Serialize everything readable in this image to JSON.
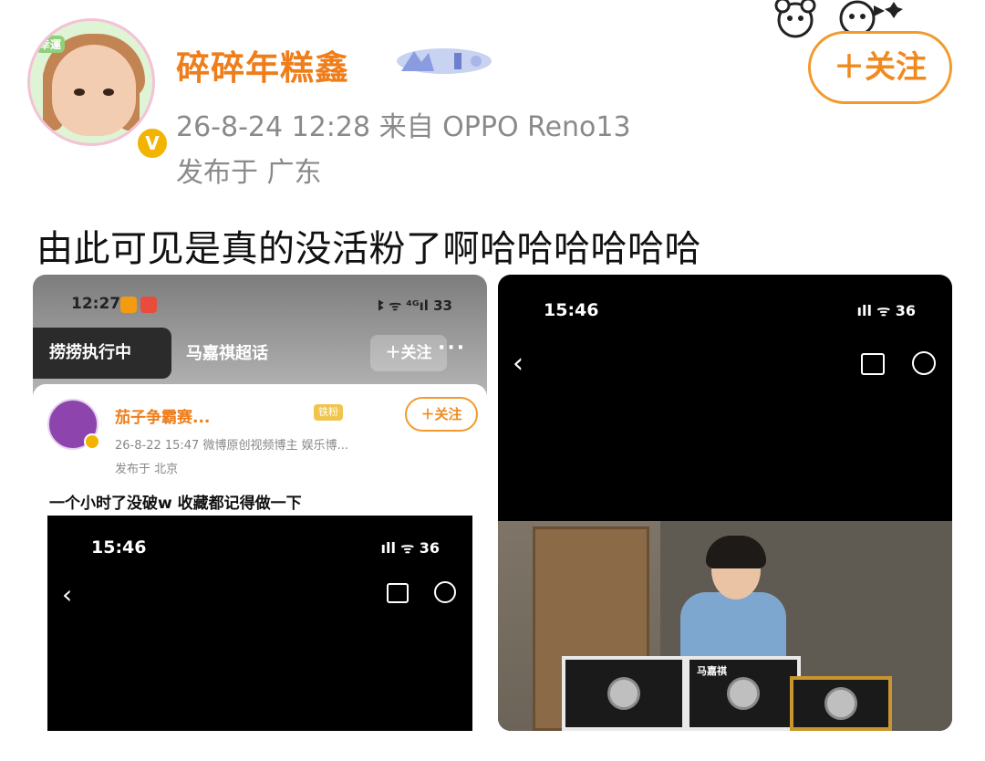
{
  "post": {
    "username": "碎碎年糕鑫",
    "avatar_tag": "幸運",
    "meta": "26-8-24 12:28  来自 OPPO Reno13",
    "location": "发布于 广东",
    "follow_label": "＋关注",
    "text": "由此可见是真的没活粉了啊哈哈哈哈哈哈"
  },
  "left_image": {
    "status_time": "12:27",
    "status_right": "ꔪ ᯤ ⁴ᴳıl 33",
    "chip_label": "捞捞执行中",
    "topic": "马嘉祺超话",
    "topic_follow": "＋关注",
    "more": "···",
    "card": {
      "name": "茄子争霸赛...",
      "name_badge": "铁粉",
      "follow_label": "＋关注",
      "meta": "26-8-22 15:47  微博原创视频博主 娱乐博...",
      "location": "发布于 北京",
      "text": "一个小时了没破w 收藏都记得做一下"
    },
    "inner": {
      "time": "15:46",
      "status_right": "ıll ᯤ 36",
      "back": "‹"
    }
  },
  "right_image": {
    "time": "15:46",
    "status_right": "ıll ᯤ 36",
    "back": "‹",
    "frame_label": "马嘉祺"
  }
}
